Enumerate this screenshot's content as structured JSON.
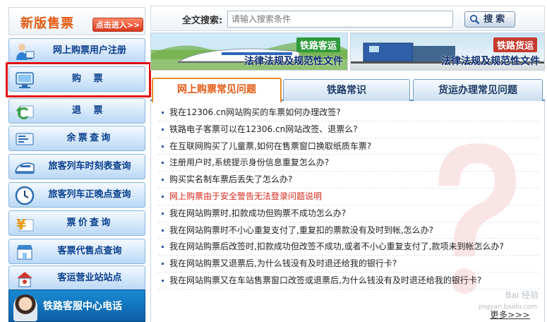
{
  "sidebar": {
    "new_version_title": "新版售票",
    "enter_button": "点击进入>>",
    "items": [
      {
        "label": "网上购票用户注册",
        "icon": "user-register-icon"
      },
      {
        "label": "购 票",
        "icon": "computer-ticket-icon"
      },
      {
        "label": "退 票",
        "icon": "return-arrow-icon"
      },
      {
        "label": "余票查询",
        "icon": "ticket-stub-icon"
      },
      {
        "label": "旅客列车时刻表查询",
        "icon": "train-icon"
      },
      {
        "label": "旅客列车正晚点查询",
        "icon": "clock-icon"
      },
      {
        "label": "票价查询",
        "icon": "yuan-price-icon"
      },
      {
        "label": "客票代售点查询",
        "icon": "shop-icon"
      },
      {
        "label": "客运营业站站点",
        "icon": "station-icon"
      }
    ],
    "service_label": "铁路客服中心电话"
  },
  "search": {
    "label": "全文搜索:",
    "placeholder": "请输入搜索条件",
    "button_label": "搜索"
  },
  "banners": {
    "left": {
      "tag": "铁路客运",
      "title": "法律法规及规范性文件"
    },
    "right": {
      "tag": "铁路货运",
      "title": "法律法规及规范性文件"
    }
  },
  "tabs": [
    {
      "label": "网上购票常见问题",
      "active": true
    },
    {
      "label": "铁路常识",
      "active": false
    },
    {
      "label": "货运办理常见问题",
      "active": false
    }
  ],
  "faq": [
    {
      "text": "我在12306.cn网站购买的车票如何办理改签?",
      "warning": false
    },
    {
      "text": "铁路电子客票可以在12306.cn网站改签、退票么?",
      "warning": false
    },
    {
      "text": "在互联网购买了儿童票,如何在售票窗口换取纸质车票?",
      "warning": false
    },
    {
      "text": "注册用户时,系统提示身份信息重复怎么办?",
      "warning": false
    },
    {
      "text": "购买实名制车票后丢失了怎么办?",
      "warning": false
    },
    {
      "text": "网上购票由于安全警告无法登录问题说明",
      "warning": true
    },
    {
      "text": "我在网站购票时,扣款成功但购票不成功怎么办?",
      "warning": false
    },
    {
      "text": "我在网站购票时不小心重复支付了,重复扣的票款没有及时到帐,怎么办?",
      "warning": false
    },
    {
      "text": "我在网站购票后改签时,扣款成功但改签不成功,或者不小心重复支付了,款项未到帐怎么办?",
      "warning": false
    },
    {
      "text": "我在网站购票又退票后,为什么钱没有及时退还给我的银行卡?",
      "warning": false
    },
    {
      "text": "我在网站购票又在车站售票窗口改签或退票后,为什么钱没有及时退还给我的银行卡?",
      "warning": false
    }
  ],
  "more_label": "更多>>>",
  "watermark": {
    "line1": "Bai 经验",
    "line2": "jingyan.baidu.com"
  },
  "colors": {
    "accent_orange": "#e35a12",
    "nav_blue": "#0b3f8e",
    "warning_red": "#d8281b",
    "highlight_frame": "#e01010"
  }
}
